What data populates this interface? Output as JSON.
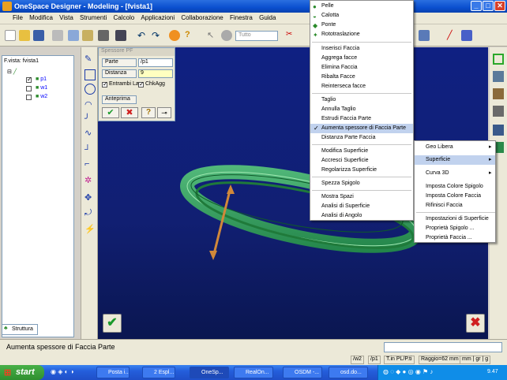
{
  "titlebar": {
    "title": "OneSpace Designer - Modeling - [fvista1]"
  },
  "menubar": {
    "items": [
      "File",
      "Modifica",
      "Vista",
      "Strumenti",
      "Calcolo",
      "Applicazioni",
      "Collaborazione",
      "Finestra",
      "Guida"
    ]
  },
  "toolbar": {
    "dropdown_value": "Tutto"
  },
  "tree": {
    "header": "F.vista: fvista1",
    "items": [
      {
        "label": "p1",
        "checked": true
      },
      {
        "label": "w1",
        "checked": false
      },
      {
        "label": "w2",
        "checked": false
      }
    ],
    "tab_label": "Struttura"
  },
  "dialog": {
    "title": "Spessore PF",
    "part_label": "Parte",
    "part_value": "/p1",
    "distance_label": "Distanza",
    "distance_value": "9",
    "both_label": "Entrambi La",
    "chkadd_label": "ChkAgg",
    "preview_label": "Anteprima"
  },
  "main_menu": {
    "items": [
      "Pelle",
      "Calotta",
      "Ponte",
      "Rototraslazione",
      "Inserisci Faccia",
      "Aggrega facce",
      "Elimina Faccia",
      "Ribalta Facce",
      "Reinterseca facce",
      "Taglio",
      "Annulla Taglio",
      "Estrudi Faccia Parte",
      "Aumenta spessore di Faccia Parte",
      "Distanza Parte Faccia",
      "Modifica Superficie",
      "Accresci Superficie",
      "Regolarizza Superficie",
      "Spezza Spigolo",
      "Mostra Spazi",
      "Analisi di Superficie",
      "Analisi di Angolo"
    ]
  },
  "sub_menu": {
    "items": [
      "Geo Libera",
      "Superficie",
      "Curva 3D",
      "Imposta Colore Spigolo",
      "Imposta Colore Faccia",
      "Rifinisci Faccia",
      "Impostazioni di Superficie",
      "Proprietà Spigolo ...",
      "Proprietà Faccia ..."
    ]
  },
  "status": {
    "message": "Aumenta spessore di Faccia Parte"
  },
  "infobar": {
    "cells": [
      "/w2",
      "/p1",
      "T.in PL/P.ti",
      "Raggio=62 mm",
      "mm | gr | g"
    ]
  },
  "taskbar": {
    "start_label": "start",
    "tasks": [
      "Posta i...",
      "2 Espl...",
      "OneSp...",
      "RealOn...",
      "OSDM -...",
      "osd.do..."
    ],
    "clock": "9.47"
  },
  "colors": {
    "accent": "#316ac5",
    "viewport": "#111f72",
    "part": "#2fae5a"
  }
}
